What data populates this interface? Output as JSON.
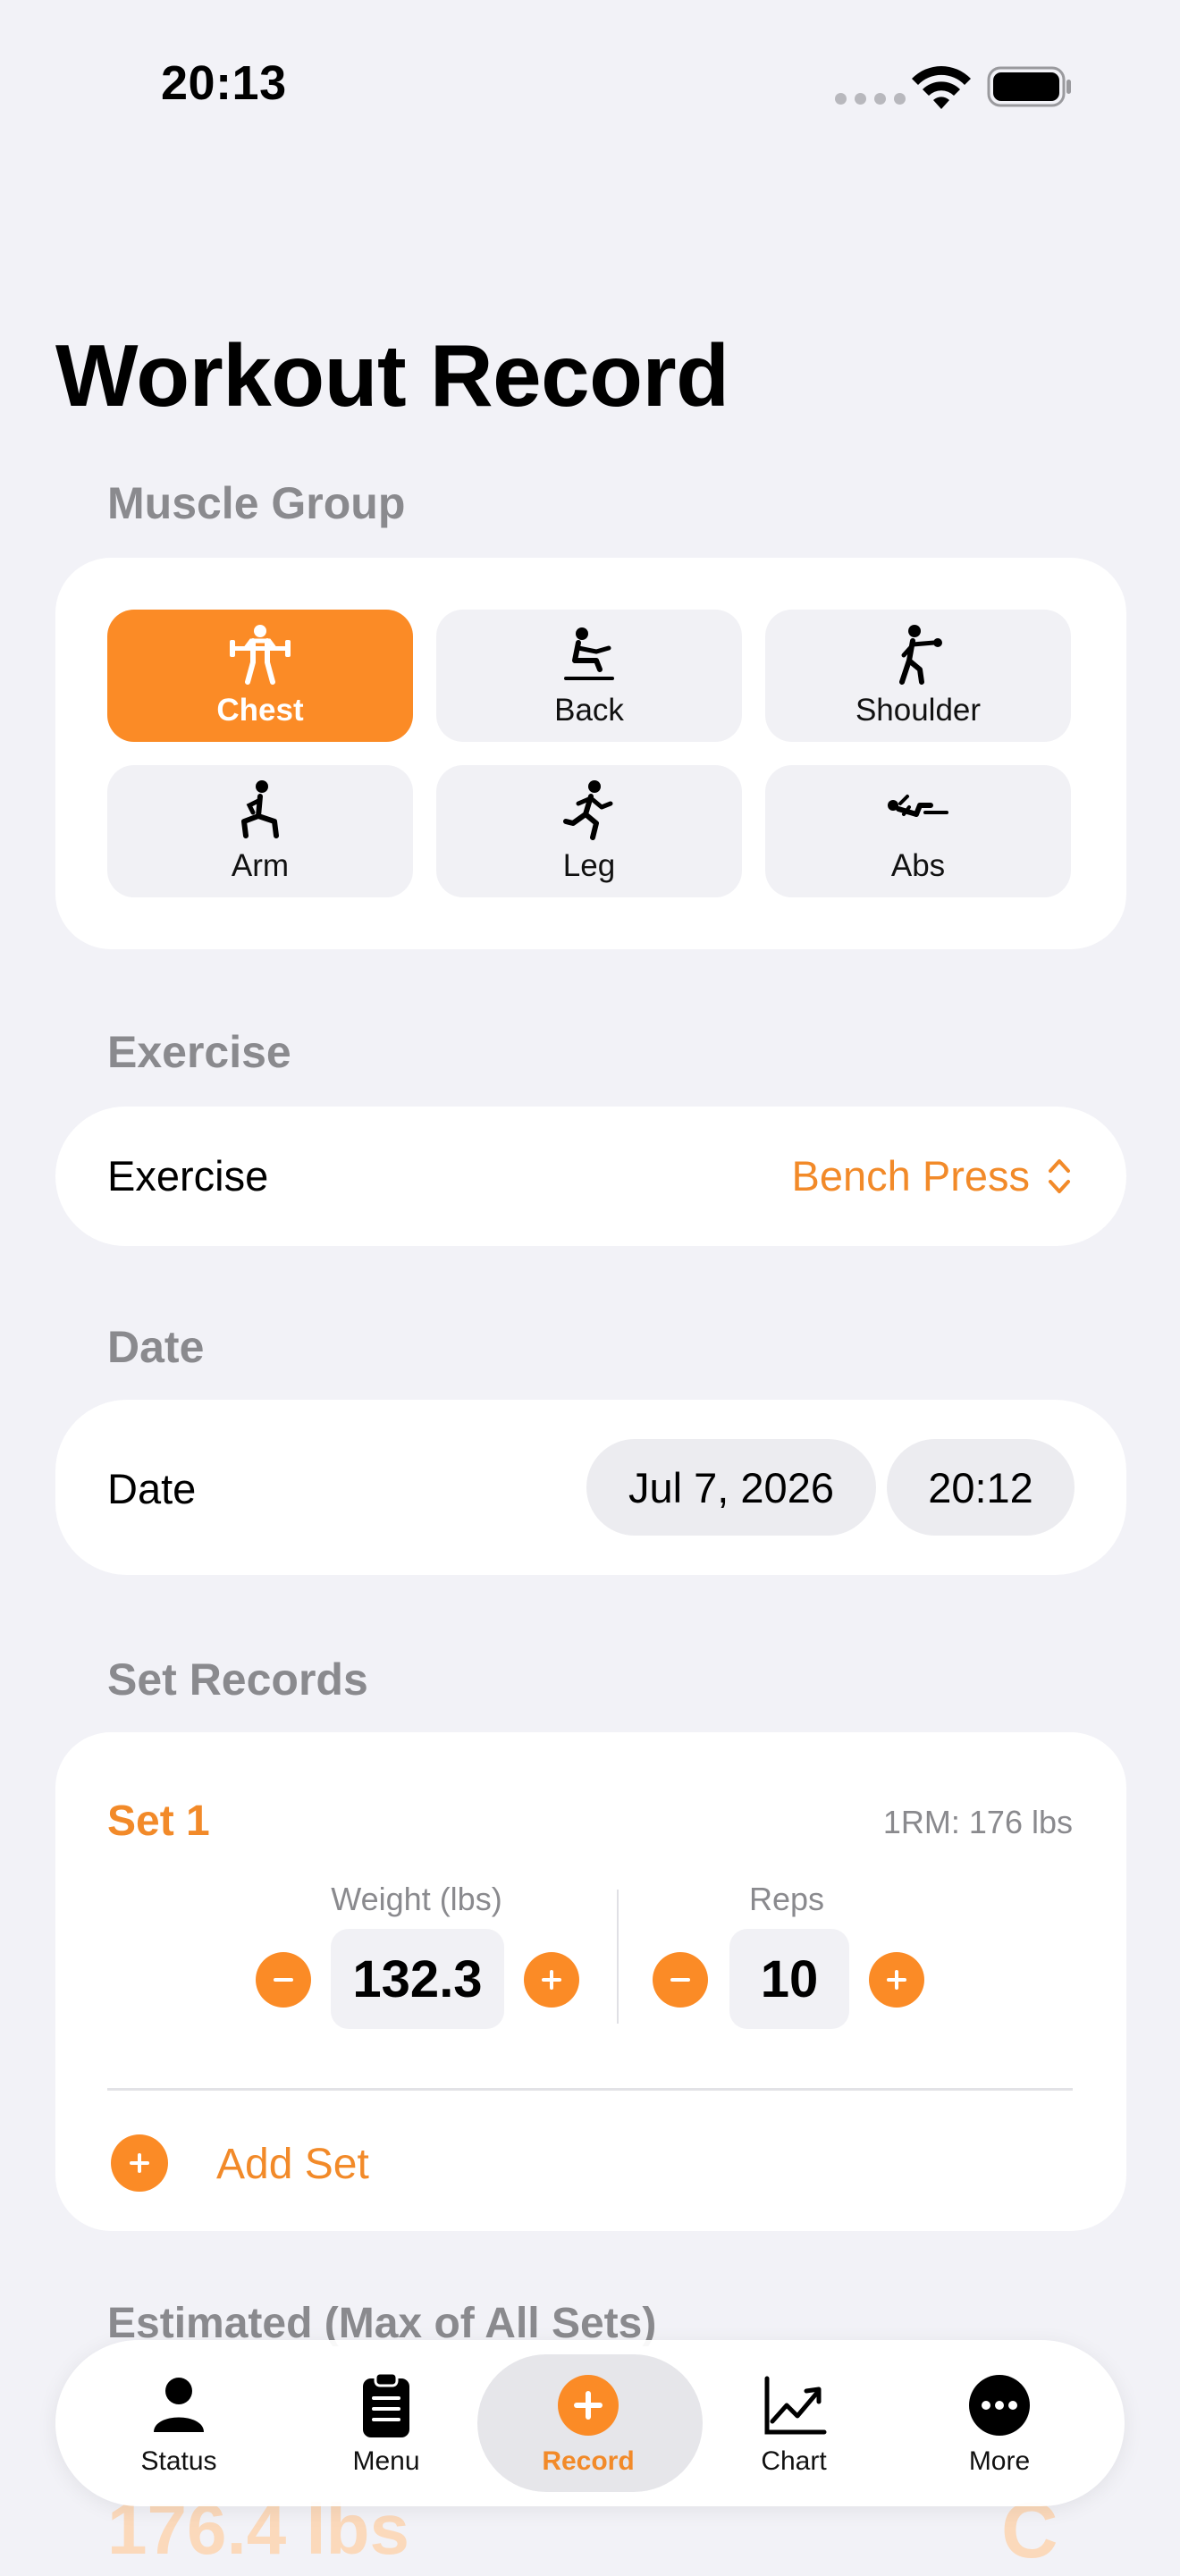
{
  "status_bar": {
    "time": "20:13"
  },
  "page": {
    "title": "Workout Record"
  },
  "muscle_group": {
    "section_label": "Muscle Group",
    "items": [
      {
        "label": "Chest",
        "icon": "barbell-figure-icon",
        "selected": true
      },
      {
        "label": "Back",
        "icon": "rowing-figure-icon",
        "selected": false
      },
      {
        "label": "Shoulder",
        "icon": "boxing-figure-icon",
        "selected": false
      },
      {
        "label": "Arm",
        "icon": "lunge-figure-icon",
        "selected": false
      },
      {
        "label": "Leg",
        "icon": "running-figure-icon",
        "selected": false
      },
      {
        "label": "Abs",
        "icon": "core-training-figure-icon",
        "selected": false
      }
    ]
  },
  "exercise": {
    "section_label": "Exercise",
    "row_label": "Exercise",
    "value": "Bench Press"
  },
  "date": {
    "section_label": "Date",
    "row_label": "Date",
    "date_value": "Jul 7, 2026",
    "time_value": "20:12"
  },
  "set_records": {
    "section_label": "Set Records",
    "sets": [
      {
        "title": "Set 1",
        "one_rm": "1RM: 176 lbs",
        "weight_label": "Weight (lbs)",
        "weight_value": "132.3",
        "reps_label": "Reps",
        "reps_value": "10"
      }
    ],
    "add_set_label": "Add Set"
  },
  "estimated": {
    "section_label": "Estimated (Max of All Sets)",
    "value": "176.4 lbs"
  },
  "tab_bar": {
    "tabs": [
      {
        "label": "Status",
        "icon": "person-icon",
        "active": false
      },
      {
        "label": "Menu",
        "icon": "clipboard-icon",
        "active": false
      },
      {
        "label": "Record",
        "icon": "plus-circle-icon",
        "active": true
      },
      {
        "label": "Chart",
        "icon": "line-chart-icon",
        "active": false
      },
      {
        "label": "More",
        "icon": "more-circle-icon",
        "active": false
      }
    ]
  },
  "colors": {
    "accent": "#fb8b26",
    "background": "#f2f2f7",
    "secondary_text": "#8a8a8e"
  }
}
